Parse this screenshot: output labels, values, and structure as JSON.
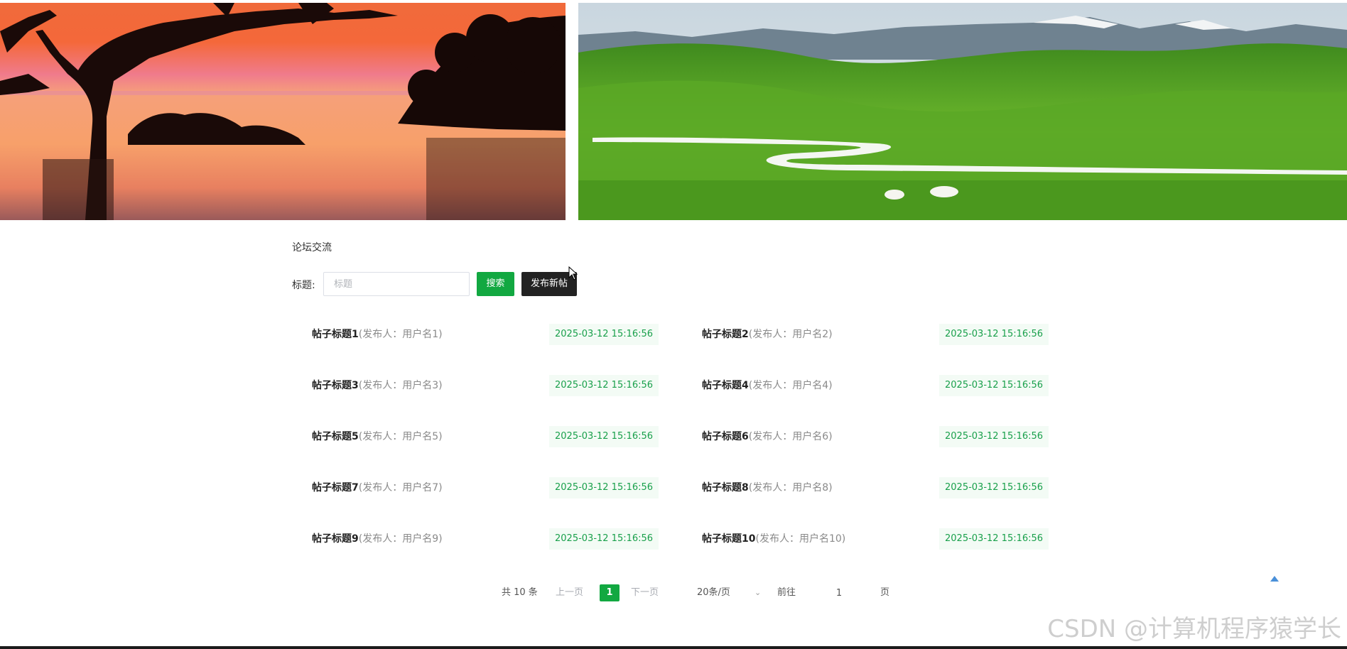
{
  "forum": {
    "section_title": "论坛交流",
    "search": {
      "label": "标题:",
      "placeholder": "标题",
      "value": "",
      "search_button": "搜索",
      "post_button": "发布新帖"
    },
    "posts": [
      {
        "title": "帖子标题1",
        "author": "(发布人：用户名1)",
        "date": "2025-03-12 15:16:56"
      },
      {
        "title": "帖子标题2",
        "author": "(发布人：用户名2)",
        "date": "2025-03-12 15:16:56"
      },
      {
        "title": "帖子标题3",
        "author": "(发布人：用户名3)",
        "date": "2025-03-12 15:16:56"
      },
      {
        "title": "帖子标题4",
        "author": "(发布人：用户名4)",
        "date": "2025-03-12 15:16:56"
      },
      {
        "title": "帖子标题5",
        "author": "(发布人：用户名5)",
        "date": "2025-03-12 15:16:56"
      },
      {
        "title": "帖子标题6",
        "author": "(发布人：用户名6)",
        "date": "2025-03-12 15:16:56"
      },
      {
        "title": "帖子标题7",
        "author": "(发布人：用户名7)",
        "date": "2025-03-12 15:16:56"
      },
      {
        "title": "帖子标题8",
        "author": "(发布人：用户名8)",
        "date": "2025-03-12 15:16:56"
      },
      {
        "title": "帖子标题9",
        "author": "(发布人：用户名9)",
        "date": "2025-03-12 15:16:56"
      },
      {
        "title": "帖子标题10",
        "author": "(发布人：用户名10)",
        "date": "2025-03-12 15:16:56"
      }
    ],
    "pagination": {
      "total": "共 10 条",
      "prev": "上一页",
      "current": "1",
      "next": "下一页",
      "page_size": "20条/页",
      "goto": "前往",
      "goto_value": "1",
      "page_unit": "页"
    }
  },
  "watermark": "CSDN @计算机程序猿学长",
  "colors": {
    "accent_green": "#12a841",
    "dark_button": "#222222",
    "date_text": "#19a04b"
  },
  "icons": {
    "cursor": "mouse-pointer-icon",
    "back_to_top": "triangle-up-icon",
    "select_arrow": "chevron-down-icon"
  }
}
